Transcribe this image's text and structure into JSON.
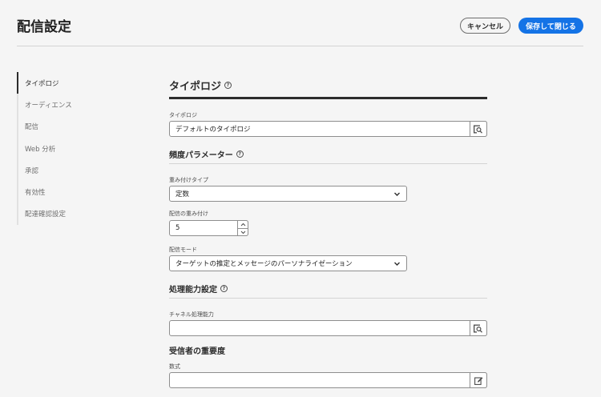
{
  "header": {
    "title": "配信設定",
    "cancel_label": "キャンセル",
    "save_label": "保存して閉じる"
  },
  "sidebar": {
    "items": [
      {
        "label": "タイポロジ",
        "active": true
      },
      {
        "label": "オーディエンス",
        "active": false
      },
      {
        "label": "配信",
        "active": false
      },
      {
        "label": "Web 分析",
        "active": false
      },
      {
        "label": "承認",
        "active": false
      },
      {
        "label": "有効性",
        "active": false
      },
      {
        "label": "配達確認設定",
        "active": false
      }
    ]
  },
  "typology": {
    "title": "タイポロジ",
    "field_label": "タイポロジ",
    "field_value": "デフォルトのタイポロジ"
  },
  "frequency": {
    "title": "頻度パラメーター",
    "weight_type_label": "重み付けタイプ",
    "weight_type_value": "定数",
    "delivery_weight_label": "配信の重み付け",
    "delivery_weight_value": "5",
    "delivery_mode_label": "配信モード",
    "delivery_mode_value": "ターゲットの推定とメッセージのパーソナライゼーション"
  },
  "capacity": {
    "title": "処理能力設定",
    "channel_capacity_label": "チャネル処理能力",
    "channel_capacity_value": ""
  },
  "importance": {
    "title": "受信者の重要度",
    "formula_label": "数式",
    "formula_value": ""
  },
  "colors": {
    "accent": "#1473e6",
    "background": "#f5f5f5"
  }
}
